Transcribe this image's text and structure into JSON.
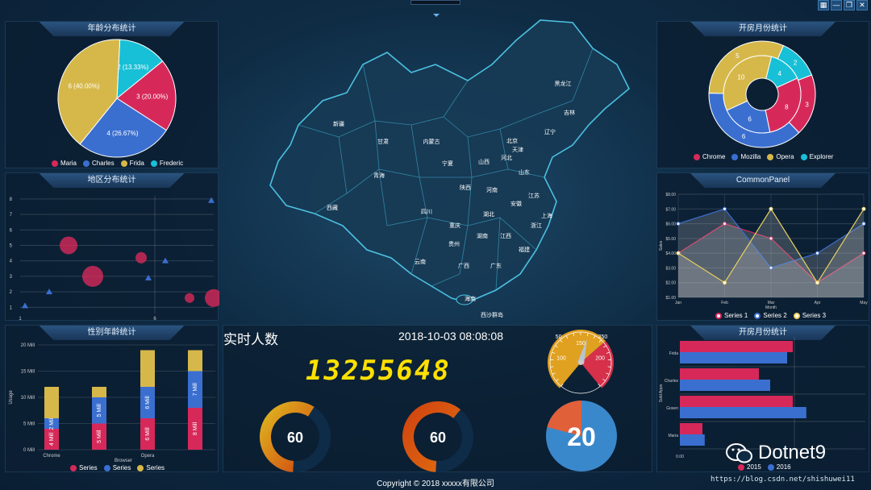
{
  "window": {
    "buttons": [
      "▦",
      "—",
      "❐",
      "✕"
    ]
  },
  "panels": {
    "age": {
      "title": "年龄分布统计"
    },
    "region": {
      "title": "地区分布统计"
    },
    "gender": {
      "title": "性别年龄统计"
    },
    "month_donut": {
      "title": "开房月份统计"
    },
    "common": {
      "title": "CommonPanel"
    },
    "month_bar": {
      "title": "开房月份统计"
    }
  },
  "realtime": {
    "label": "实时人数",
    "datetime": "2018-10-03 08:08:08",
    "count": "13255648"
  },
  "gauges": {
    "g1": "60",
    "g2": "60",
    "g3": "20"
  },
  "speedometer": {
    "ticks": [
      "50",
      "100",
      "150",
      "200",
      "250"
    ]
  },
  "footer": "Copyright © 2018 xxxxx有限公司",
  "watermark": "Dotnet9",
  "url": "https://blog.csdn.net/shishuwei11",
  "map_labels": [
    "黑龙江",
    "吉林",
    "辽宁",
    "北京",
    "天津",
    "河北",
    "山西",
    "内蒙古",
    "新疆",
    "甘肃",
    "宁夏",
    "陕西",
    "青海",
    "西藏",
    "四川",
    "重庆",
    "湖北",
    "河南",
    "山东",
    "江苏",
    "安徽",
    "上海",
    "浙江",
    "湖南",
    "江西",
    "福建",
    "贵州",
    "云南",
    "广西",
    "广东",
    "海南",
    "西沙群岛"
  ],
  "chart_data": [
    {
      "type": "pie",
      "title": "年龄分布统计",
      "slices": [
        {
          "name": "Maria",
          "value": 3,
          "label": "3 (20.00%)",
          "color": "#d6295a"
        },
        {
          "name": "Charles",
          "value": 4,
          "label": "4 (26.67%)",
          "color": "#3a6fd0"
        },
        {
          "name": "Frida",
          "value": 6,
          "label": "6 (40.00%)",
          "color": "#d6b84a"
        },
        {
          "name": "Frederic",
          "value": 2,
          "label": "2 (13.33%)",
          "color": "#17c0d6"
        }
      ]
    },
    {
      "type": "scatter",
      "title": "地区分布统计",
      "y_ticks": [
        "1",
        "2",
        "3",
        "4",
        "5",
        "6",
        "7",
        "8"
      ],
      "x_ticks": [
        "1",
        "6"
      ],
      "bubbles": [
        {
          "x": 2,
          "y": 5,
          "r": 11,
          "color": "#d6295a"
        },
        {
          "x": 3,
          "y": 3,
          "r": 13,
          "color": "#d6295a"
        },
        {
          "x": 5,
          "y": 4.2,
          "r": 7,
          "color": "#d6295a"
        },
        {
          "x": 7,
          "y": 1.6,
          "r": 6,
          "color": "#d6295a"
        },
        {
          "x": 8,
          "y": 1.6,
          "r": 11,
          "color": "#d6295a"
        }
      ],
      "triangles": [
        {
          "x": 0.2,
          "y": 1.1
        },
        {
          "x": 1.2,
          "y": 2
        },
        {
          "x": 5.3,
          "y": 2.9
        },
        {
          "x": 6,
          "y": 4
        },
        {
          "x": 7.9,
          "y": 7.9
        }
      ]
    },
    {
      "type": "bar",
      "title": "性别年龄统计",
      "y_ticks": [
        "0 Mill",
        "5 Mill",
        "10 Mill",
        "15 Mill",
        "20 Mill"
      ],
      "ylabel": "Usage",
      "xlabel": "Browser",
      "categories": [
        "Chrome",
        "",
        "Opera",
        ""
      ],
      "series": [
        {
          "name": "Series",
          "color": "#d6295a",
          "values": [
            4,
            5,
            6,
            8
          ],
          "labels": [
            "4 Mill",
            "5 Mill",
            "6 Mill",
            "8 Mill"
          ]
        },
        {
          "name": "Series",
          "color": "#3a6fd0",
          "values": [
            2,
            5,
            6,
            7
          ],
          "labels": [
            "2 Mill",
            "5 Mill",
            "6 Mill",
            "7 Mill"
          ]
        },
        {
          "name": "Series",
          "color": "#d6b84a",
          "values": [
            6,
            2,
            7,
            4
          ]
        }
      ]
    },
    {
      "type": "pie",
      "title": "开房月份统计",
      "inner": [
        {
          "name": "Opera",
          "value": 10,
          "color": "#d6b84a"
        },
        {
          "name": "Explorer",
          "value": 4,
          "color": "#17c0d6"
        },
        {
          "name": "Chrome",
          "value": 8,
          "color": "#d6295a"
        },
        {
          "name": "Mozilla",
          "value": 6,
          "color": "#3a6fd0"
        }
      ],
      "outer": [
        {
          "value": 5,
          "color": "#d6b84a"
        },
        {
          "value": 2,
          "color": "#17c0d6"
        },
        {
          "value": 3,
          "color": "#d6295a"
        },
        {
          "value": 6,
          "color": "#3a6fd0"
        }
      ],
      "legend": [
        {
          "name": "Chrome",
          "color": "#d6295a"
        },
        {
          "name": "Mozilla",
          "color": "#3a6fd0"
        },
        {
          "name": "Opera",
          "color": "#d6b84a"
        },
        {
          "name": "Explorer",
          "color": "#17c0d6"
        }
      ]
    },
    {
      "type": "line",
      "title": "CommonPanel",
      "categories": [
        "Jan",
        "Feb",
        "Mar",
        "Apr",
        "May"
      ],
      "xlabel": "Month",
      "ylabel": "Sales",
      "y_ticks": [
        "$1.00",
        "$2.00",
        "$3.00",
        "$4.00",
        "$5.00",
        "$6.00",
        "$7.00",
        "$8.00"
      ],
      "ylim": [
        1,
        8
      ],
      "series": [
        {
          "name": "Series 1",
          "color": "#d6295a",
          "values": [
            4,
            6,
            5,
            2,
            4
          ]
        },
        {
          "name": "Series 2",
          "color": "#3a6fd0",
          "values": [
            6,
            7,
            3,
            4,
            6
          ]
        },
        {
          "name": "Series 3",
          "color": "#e8d060",
          "values": [
            4,
            2,
            7,
            2,
            7
          ]
        }
      ]
    },
    {
      "type": "bar",
      "title": "开房月份统计",
      "orientation": "horizontal",
      "categories": [
        "Frida",
        "Charles",
        "Gosen",
        "Maria"
      ],
      "ylabel": "Sold Apps",
      "x_ticks": [
        "0.00"
      ],
      "series": [
        {
          "name": "2015",
          "color": "#d6295a",
          "values": [
            10,
            7,
            10,
            2
          ]
        },
        {
          "name": "2016",
          "color": "#3a6fd0",
          "values": [
            9.5,
            8,
            11.2,
            2.2
          ]
        }
      ]
    }
  ],
  "legends": {
    "age": [
      "Maria",
      "Charles",
      "Frida",
      "Frederic"
    ],
    "gender": [
      "Series",
      "Series",
      "Series"
    ],
    "month_donut": [
      "Chrome",
      "Mozilla",
      "Opera",
      "Explorer"
    ],
    "common": [
      "Series 1",
      "Series 2",
      "Series 3"
    ],
    "month_bar": [
      "2015",
      "2016"
    ]
  }
}
